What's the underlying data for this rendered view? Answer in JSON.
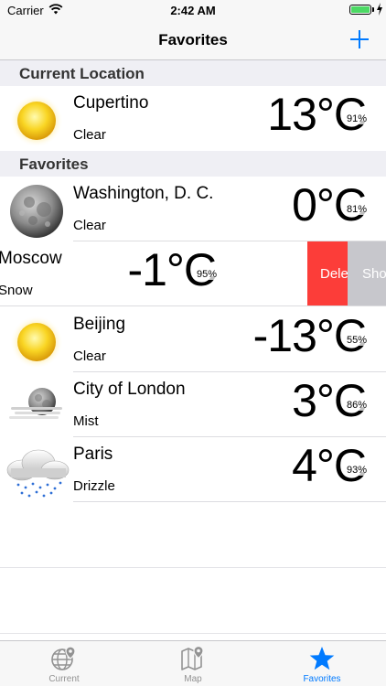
{
  "status_bar": {
    "carrier": "Carrier",
    "time": "2:42 AM"
  },
  "nav": {
    "title": "Favorites",
    "add_icon": "plus-icon"
  },
  "sections": {
    "current_location": "Current Location",
    "favorites": "Favorites"
  },
  "current": {
    "city": "Cupertino",
    "condition": "Clear",
    "temp": "13°C",
    "humidity": "91%",
    "icon": "sun-icon"
  },
  "favorites": [
    {
      "city": "Washington, D. C.",
      "condition": "Clear",
      "temp": "0°C",
      "humidity": "81%",
      "icon": "moon-icon"
    },
    {
      "city": "Moscow",
      "condition": "Snow",
      "temp": "-1°C",
      "humidity": "95%",
      "icon": "none"
    },
    {
      "city": "Beijing",
      "condition": "Clear",
      "temp": "-13°C",
      "humidity": "55%",
      "icon": "sun-icon"
    },
    {
      "city": "City of London",
      "condition": "Mist",
      "temp": "3°C",
      "humidity": "86%",
      "icon": "mist-icon"
    },
    {
      "city": "Paris",
      "condition": "Drizzle",
      "temp": "4°C",
      "humidity": "93%",
      "icon": "drizzle-icon"
    }
  ],
  "swipe_actions": {
    "delete_label": "Delete",
    "show_label": "Show"
  },
  "tabs": [
    {
      "label": "Current",
      "icon": "globe-pin-icon",
      "active": false
    },
    {
      "label": "Map",
      "icon": "map-pin-icon",
      "active": false
    },
    {
      "label": "Favorites",
      "icon": "star-icon",
      "active": true
    }
  ],
  "colors": {
    "accent": "#007aff",
    "delete": "#fc3d39",
    "show": "#c7c7cc",
    "battery": "#4cd964"
  }
}
